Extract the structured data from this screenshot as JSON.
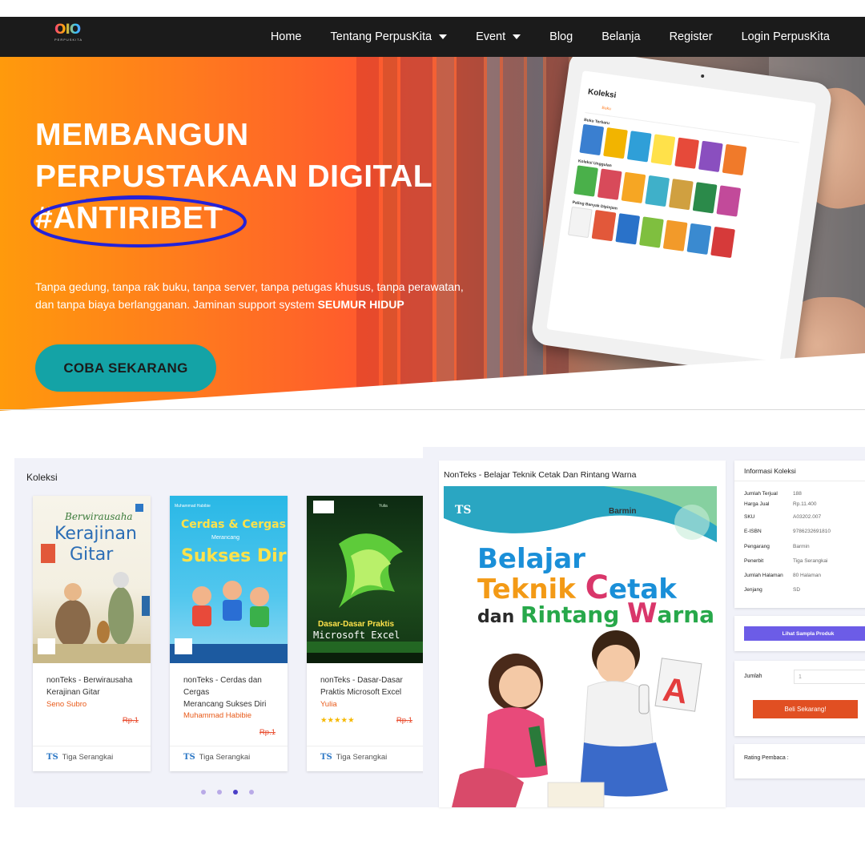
{
  "navbar": {
    "logo_mark": "OIO",
    "logo_word": "PERPUSKITA",
    "items": [
      {
        "label": "Home",
        "dropdown": false
      },
      {
        "label": "Tentang PerpusKita",
        "dropdown": true
      },
      {
        "label": "Event",
        "dropdown": true
      },
      {
        "label": "Blog",
        "dropdown": false
      },
      {
        "label": "Belanja",
        "dropdown": false
      },
      {
        "label": "Register",
        "dropdown": false
      },
      {
        "label": "Login PerpusKita",
        "dropdown": false
      }
    ]
  },
  "hero": {
    "title_line1": "MEMBANGUN",
    "title_line2": "PERPUSTAKAAN DIGITAL",
    "title_line3": "#ANTIRIBET",
    "description": "Tanpa gedung, tanpa rak buku, tanpa server, tanpa petugas khusus, tanpa perawatan, dan tanpa biaya berlangganan. Jaminan support system",
    "description_emphasis": "SEUMUR HIDUP",
    "cta_label": "COBA SEKARANG",
    "tablet": {
      "screen_title": "Koleksi",
      "tab_active": "Buku",
      "section1": "Buku Terbaru",
      "section2": "Koleksi Unggulan",
      "section3": "Paling Banyak Dipinjam"
    }
  },
  "koleksi": {
    "title": "Koleksi",
    "books": [
      {
        "name_line1": "nonTeks - Berwirausaha",
        "name_line2": "Kerajinan Gitar",
        "name_line3": "",
        "author": "Seno Subro",
        "price": "Rp.1",
        "rating": "",
        "publisher": "Tiga Serangkai",
        "cover_title1": "Berwirausaha",
        "cover_title2": "Kerajinan",
        "cover_title3": "Gitar",
        "cover_author": ""
      },
      {
        "name_line1": "nonTeks - Cerdas dan",
        "name_line2": "Cergas",
        "name_line3": "Merancang Sukses Diri",
        "author": "Muhammad Habibie",
        "price": "Rp.1",
        "rating": "",
        "publisher": "Tiga Serangkai",
        "cover_title1": "Cerdas & Cergas",
        "cover_title2": "Merancang",
        "cover_title3": "Sukses Diri",
        "cover_author": "Muhammad Habibie"
      },
      {
        "name_line1": "nonTeks - Dasar-Dasar",
        "name_line2": "Praktis Microsoft Excel",
        "name_line3": "",
        "author": "Yulia",
        "price": "Rp.1",
        "rating": "★★★★★",
        "publisher": "Tiga Serangkai",
        "cover_title1": "Dasar-Dasar Praktis",
        "cover_title2": "Microsoft Excel",
        "cover_title3": "",
        "cover_author": "Yulia"
      }
    ],
    "carousel_pages": 4,
    "carousel_active": 3
  },
  "detail": {
    "title": "NonTeks - Belajar Teknik Cetak Dan Rintang Warna",
    "cover": {
      "publisher_mark": "TS",
      "author": "Barmin",
      "line1": "Belajar",
      "line2a": "Teknik ",
      "line2b": "C",
      "line2c": "etak",
      "line3a": "dan ",
      "line3b": "Rintang ",
      "line3c": "W",
      "line3d": "arna"
    },
    "info": {
      "heading": "Informasi Koleksi",
      "rows": [
        {
          "key": "Jumlah Terjual",
          "value": "188"
        },
        {
          "key": "Harga Jual",
          "value": "Rp.11.400"
        },
        {
          "key": "SKU",
          "value": "A03202.007"
        },
        {
          "key": "E-ISBN",
          "value": "9786232691810"
        },
        {
          "key": "Pengarang",
          "value": "Barmin"
        },
        {
          "key": "Penerbit",
          "value": "Tiga Serangkai"
        },
        {
          "key": "Jumlah Halaman",
          "value": "80 Halaman"
        },
        {
          "key": "Jenjang",
          "value": "SD"
        }
      ]
    },
    "sample_button": "Lihat Sampla Produk",
    "quantity_label": "Jumlah",
    "quantity_value": "1",
    "buy_button": "Beli Sekarang!",
    "rating_label": "Rating Pembaca :"
  },
  "colors": {
    "nav_bg": "#1b1b1b",
    "cta": "#14a3a6",
    "accent_orange": "#e14f22",
    "sample_purple": "#6c5ce7",
    "panel_bg": "#f1f2f9"
  }
}
